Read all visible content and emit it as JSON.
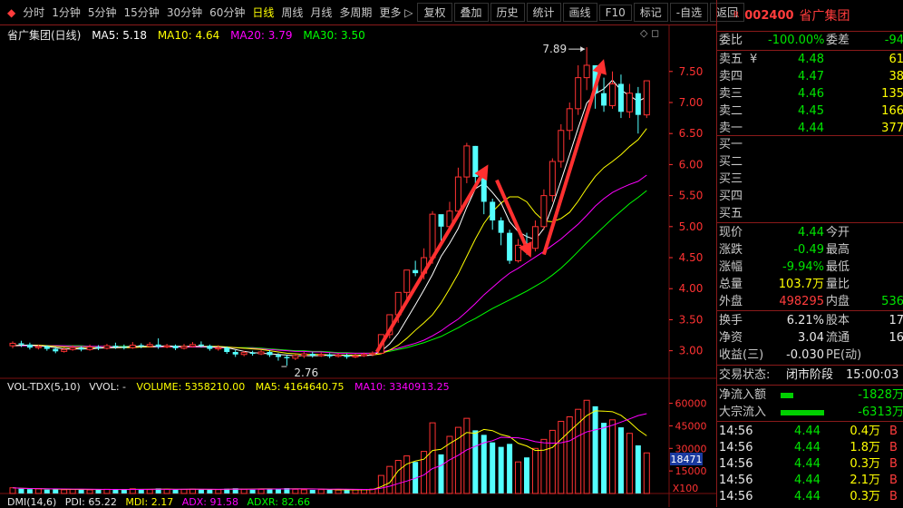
{
  "toolbar": [
    {
      "label": "分时"
    },
    {
      "label": "1分钟"
    },
    {
      "label": "5分钟"
    },
    {
      "label": "15分钟"
    },
    {
      "label": "30分钟"
    },
    {
      "label": "60分钟"
    },
    {
      "label": "日线",
      "active": true
    },
    {
      "label": "周线"
    },
    {
      "label": "月线"
    },
    {
      "label": "多周期"
    },
    {
      "label": "更多 ▷"
    },
    {
      "label": "复权",
      "box": true
    },
    {
      "label": "叠加",
      "box": true
    },
    {
      "label": "历史",
      "box": true
    },
    {
      "label": "统计",
      "box": true
    },
    {
      "label": "画线",
      "box": true
    },
    {
      "label": "F10",
      "box": true
    },
    {
      "label": "标记",
      "box": true
    },
    {
      "label": "-自选",
      "box": true
    },
    {
      "label": "返回",
      "box": true
    }
  ],
  "stock": {
    "badge": "R",
    "code": "002400",
    "name": "省广集团"
  },
  "main_info": {
    "title": "省广集团(日线)",
    "ma5": "MA5: 5.18",
    "ma10": "MA10: 4.64",
    "ma20": "MA20: 3.79",
    "ma30": "MA30: 3.50"
  },
  "vol_info": {
    "title": "VOL-TDX(5,10)",
    "vvol": "VVOL: -",
    "volume": "VOLUME: 5358210.00",
    "ma5": "MA5: 4164640.75",
    "ma10": "MA10: 3340913.25"
  },
  "dmi_info": {
    "title": "DMI(14,6)",
    "pdi": "PDI: 65.22",
    "mdi": "MDI: 2.17",
    "adx": "ADX: 91.58",
    "adxr": "ADXR: 82.66"
  },
  "colors": {
    "up": "#ff3232",
    "down": "#54ffff",
    "ma5": "#ffffff",
    "ma10": "#ffff00",
    "ma20": "#ff00ff",
    "ma30": "#00ff00",
    "grid": "#7a1010"
  },
  "chart_data": {
    "type": "candlestick",
    "ylim": [
      2.6,
      7.95
    ],
    "yticks": [
      "7.50",
      "7.00",
      "6.50",
      "6.00",
      "5.50",
      "5.00",
      "4.50",
      "4.00",
      "3.50",
      "3.00"
    ],
    "annotations": {
      "high": "7.89",
      "low": "2.76"
    },
    "candles": [
      [
        3.08,
        3.12,
        3.15,
        3.04
      ],
      [
        3.12,
        3.1,
        3.16,
        3.06
      ],
      [
        3.1,
        3.05,
        3.13,
        3.02
      ],
      [
        3.05,
        3.07,
        3.1,
        3.02
      ],
      [
        3.07,
        3.03,
        3.09,
        3.0
      ],
      [
        3.03,
        2.99,
        3.06,
        2.96
      ],
      [
        2.99,
        3.02,
        3.05,
        2.97
      ],
      [
        3.02,
        3.05,
        3.09,
        3.0
      ],
      [
        3.05,
        3.02,
        3.07,
        2.99
      ],
      [
        3.02,
        3.06,
        3.1,
        3.0
      ],
      [
        3.06,
        3.04,
        3.09,
        3.01
      ],
      [
        3.04,
        3.08,
        3.11,
        3.02
      ],
      [
        3.08,
        3.06,
        3.13,
        3.03
      ],
      [
        3.06,
        3.05,
        3.1,
        3.02
      ],
      [
        3.05,
        3.09,
        3.14,
        3.03
      ],
      [
        3.09,
        3.07,
        3.12,
        3.04
      ],
      [
        3.07,
        3.1,
        3.14,
        3.05
      ],
      [
        3.1,
        3.06,
        3.2,
        3.03
      ],
      [
        3.06,
        3.08,
        3.11,
        3.04
      ],
      [
        3.08,
        3.04,
        3.1,
        3.01
      ],
      [
        3.04,
        3.07,
        3.11,
        3.02
      ],
      [
        3.07,
        3.1,
        3.14,
        3.05
      ],
      [
        3.1,
        3.08,
        3.15,
        3.05
      ],
      [
        3.08,
        3.03,
        3.1,
        3.0
      ],
      [
        3.03,
        3.05,
        3.09,
        3.0
      ],
      [
        3.05,
        2.98,
        3.07,
        2.95
      ],
      [
        2.98,
        2.94,
        3.01,
        2.9
      ],
      [
        2.94,
        2.97,
        3.0,
        2.91
      ],
      [
        2.97,
        2.95,
        3.0,
        2.92
      ],
      [
        2.95,
        2.98,
        3.01,
        2.93
      ],
      [
        2.98,
        2.93,
        3.01,
        2.9
      ],
      [
        2.93,
        2.9,
        2.96,
        2.84
      ],
      [
        2.9,
        2.88,
        2.93,
        2.76
      ],
      [
        2.88,
        2.92,
        2.95,
        2.85
      ],
      [
        2.92,
        2.95,
        2.98,
        2.88
      ],
      [
        2.95,
        2.92,
        2.98,
        2.89
      ],
      [
        2.92,
        2.94,
        2.97,
        2.9
      ],
      [
        2.94,
        2.91,
        2.96,
        2.88
      ],
      [
        2.91,
        2.93,
        2.96,
        2.89
      ],
      [
        2.93,
        2.9,
        2.95,
        2.87
      ],
      [
        2.9,
        2.92,
        2.95,
        2.88
      ],
      [
        2.92,
        2.94,
        2.97,
        2.9
      ],
      [
        2.94,
        2.96,
        2.99,
        2.91
      ],
      [
        2.96,
        3.26,
        3.26,
        2.95
      ],
      [
        3.26,
        3.58,
        3.58,
        3.2
      ],
      [
        3.58,
        3.94,
        3.94,
        3.45
      ],
      [
        3.94,
        4.3,
        4.3,
        3.8
      ],
      [
        4.3,
        4.25,
        4.45,
        4.2
      ],
      [
        4.25,
        4.5,
        4.65,
        4.15
      ],
      [
        4.5,
        5.2,
        5.25,
        4.4
      ],
      [
        5.2,
        5.0,
        5.15,
        4.7
      ],
      [
        5.0,
        5.25,
        5.4,
        4.95
      ],
      [
        5.25,
        5.8,
        5.95,
        5.15
      ],
      [
        5.8,
        6.3,
        6.35,
        5.7
      ],
      [
        6.3,
        5.8,
        6.3,
        5.6
      ],
      [
        5.8,
        5.4,
        5.9,
        5.2
      ],
      [
        5.4,
        5.1,
        5.45,
        4.95
      ],
      [
        5.1,
        4.9,
        5.15,
        4.7
      ],
      [
        4.9,
        4.45,
        4.95,
        4.4
      ],
      [
        4.45,
        4.7,
        4.8,
        4.42
      ],
      [
        4.7,
        4.65,
        4.9,
        4.55
      ],
      [
        4.65,
        5.0,
        5.1,
        4.6
      ],
      [
        5.0,
        5.5,
        5.6,
        4.95
      ],
      [
        5.5,
        6.05,
        6.1,
        5.4
      ],
      [
        6.05,
        6.55,
        6.65,
        5.95
      ],
      [
        6.55,
        6.9,
        7.0,
        6.4
      ],
      [
        6.9,
        7.4,
        7.6,
        6.8
      ],
      [
        7.4,
        7.6,
        7.89,
        7.2
      ],
      [
        7.6,
        7.15,
        7.6,
        6.9
      ],
      [
        7.15,
        6.95,
        7.4,
        6.85
      ],
      [
        6.95,
        7.3,
        7.5,
        6.9
      ],
      [
        7.3,
        6.85,
        7.45,
        6.75
      ],
      [
        6.85,
        7.15,
        7.3,
        6.75
      ],
      [
        7.15,
        6.8,
        7.25,
        6.5
      ],
      [
        6.8,
        7.35,
        7.35,
        6.75
      ]
    ],
    "ma5": [
      3.08,
      3.09,
      3.09,
      3.08,
      3.07,
      3.05,
      3.03,
      3.03,
      3.03,
      3.03,
      3.04,
      3.05,
      3.05,
      3.06,
      3.07,
      3.07,
      3.07,
      3.07,
      3.08,
      3.07,
      3.07,
      3.07,
      3.07,
      3.06,
      3.06,
      3.05,
      3.02,
      2.99,
      2.97,
      2.96,
      2.95,
      2.94,
      2.93,
      2.92,
      2.92,
      2.92,
      2.92,
      2.93,
      2.93,
      2.92,
      2.92,
      2.92,
      2.93,
      2.99,
      3.11,
      3.28,
      3.51,
      3.74,
      3.98,
      4.23,
      4.52,
      4.73,
      4.97,
      5.31,
      5.61,
      5.7,
      5.55,
      5.38,
      5.08,
      4.92,
      4.84,
      4.79,
      4.97,
      5.33,
      5.74,
      6.16,
      6.59,
      6.99,
      7.14,
      7.22,
      7.36,
      7.2,
      7.11,
      7.02,
      7.09
    ],
    "ma10": [
      3.08,
      3.09,
      3.09,
      3.09,
      3.08,
      3.07,
      3.06,
      3.05,
      3.05,
      3.05,
      3.05,
      3.05,
      3.05,
      3.05,
      3.05,
      3.06,
      3.06,
      3.07,
      3.07,
      3.07,
      3.07,
      3.07,
      3.07,
      3.07,
      3.07,
      3.06,
      3.05,
      3.04,
      3.03,
      3.02,
      3.0,
      2.98,
      2.96,
      2.95,
      2.94,
      2.94,
      2.94,
      2.93,
      2.93,
      2.93,
      2.93,
      2.93,
      2.93,
      2.95,
      3.01,
      3.09,
      3.2,
      3.33,
      3.45,
      3.58,
      3.77,
      4.0,
      4.24,
      4.52,
      4.8,
      5.05,
      5.24,
      5.38,
      5.48,
      5.48,
      5.4,
      5.22,
      5.09,
      5.08,
      5.13,
      5.23,
      5.41,
      5.62,
      5.81,
      5.95,
      6.05,
      6.16,
      6.29,
      6.4,
      6.58
    ],
    "ma20": [
      3.08,
      3.08,
      3.08,
      3.08,
      3.08,
      3.08,
      3.08,
      3.07,
      3.07,
      3.07,
      3.07,
      3.07,
      3.06,
      3.06,
      3.06,
      3.06,
      3.06,
      3.06,
      3.06,
      3.06,
      3.06,
      3.06,
      3.06,
      3.06,
      3.05,
      3.05,
      3.05,
      3.04,
      3.04,
      3.03,
      3.02,
      3.01,
      3.0,
      2.99,
      2.99,
      2.98,
      2.98,
      2.97,
      2.96,
      2.96,
      2.96,
      2.96,
      2.96,
      2.98,
      3.01,
      3.04,
      3.08,
      3.12,
      3.17,
      3.24,
      3.32,
      3.42,
      3.51,
      3.63,
      3.76,
      3.9,
      4.02,
      4.14,
      4.25,
      4.33,
      4.42,
      4.51,
      4.6,
      4.7,
      4.8,
      4.92,
      5.04,
      5.18,
      5.33,
      5.45,
      5.55,
      5.62,
      5.68,
      5.73,
      5.83
    ],
    "ma30": [
      3.08,
      3.08,
      3.08,
      3.08,
      3.08,
      3.08,
      3.08,
      3.08,
      3.08,
      3.07,
      3.07,
      3.07,
      3.07,
      3.07,
      3.07,
      3.07,
      3.07,
      3.07,
      3.07,
      3.07,
      3.07,
      3.06,
      3.06,
      3.06,
      3.06,
      3.05,
      3.05,
      3.05,
      3.05,
      3.04,
      3.03,
      3.02,
      3.01,
      3.0,
      3.0,
      2.99,
      2.99,
      2.98,
      2.97,
      2.97,
      2.96,
      2.96,
      2.96,
      2.97,
      2.99,
      3.02,
      3.05,
      3.09,
      3.13,
      3.18,
      3.23,
      3.3,
      3.37,
      3.45,
      3.52,
      3.6,
      3.68,
      3.75,
      3.82,
      3.89,
      3.96,
      4.04,
      4.12,
      4.22,
      4.33,
      4.46,
      4.6,
      4.74,
      4.87,
      5.0,
      5.13,
      5.25,
      5.37,
      5.47,
      5.58
    ],
    "volume": [
      3800,
      3200,
      2900,
      3100,
      2600,
      2800,
      2500,
      2700,
      3000,
      2400,
      2600,
      2800,
      2900,
      2500,
      3100,
      2700,
      2600,
      3400,
      2800,
      2500,
      2700,
      2900,
      3000,
      2400,
      2600,
      3200,
      3500,
      2800,
      2500,
      2700,
      2900,
      3300,
      3600,
      2800,
      2500,
      2400,
      2600,
      2500,
      2300,
      2600,
      2400,
      2700,
      2900,
      12000,
      18000,
      22000,
      25000,
      21000,
      28000,
      47000,
      26000,
      38000,
      44000,
      50000,
      42000,
      39000,
      34000,
      31000,
      33000,
      21000,
      24000,
      30000,
      36000,
      42000,
      48000,
      51000,
      56000,
      62000,
      58000,
      47000,
      49000,
      44000,
      40000,
      32000,
      27000
    ],
    "vol_ma5": [
      3800,
      3500,
      3300,
      3250,
      3120,
      2920,
      2780,
      2740,
      2720,
      2680,
      2640,
      2700,
      2740,
      2640,
      2780,
      2800,
      2760,
      2860,
      2920,
      2800,
      2800,
      2880,
      2780,
      2700,
      2740,
      2760,
      2940,
      2900,
      2920,
      3060,
      3080,
      3040,
      3120,
      3160,
      3120,
      3060,
      2940,
      2680,
      2460,
      2480,
      2480,
      2500,
      2580,
      4500,
      7200,
      15200,
      19600,
      21600,
      22800,
      28600,
      29400,
      33200,
      36600,
      40600,
      40000,
      42600,
      41800,
      39200,
      37800,
      33400,
      31600,
      28600,
      28800,
      30600,
      36000,
      41400,
      46600,
      51800,
      55000,
      54800,
      54400,
      52000,
      47600,
      42400,
      38400
    ],
    "vol_ma10": [
      3800,
      3500,
      3300,
      3250,
      3120,
      3070,
      3010,
      2970,
      2970,
      2900,
      2780,
      2740,
      2730,
      2670,
      2730,
      2720,
      2760,
      2830,
      2810,
      2820,
      2830,
      2850,
      2860,
      2830,
      2780,
      2850,
      2930,
      2880,
      2830,
      2930,
      2950,
      3020,
      3020,
      3050,
      3070,
      3000,
      2910,
      2880,
      2940,
      2900,
      2780,
      2720,
      2630,
      3570,
      4820,
      6600,
      8260,
      10140,
      12320,
      16600,
      18600,
      22400,
      25400,
      29000,
      31400,
      33700,
      35100,
      37400,
      37200,
      37000,
      36000,
      34500,
      33700,
      33500,
      33700,
      35000,
      38200,
      41000,
      42300,
      43700,
      45400,
      47500,
      49600,
      51800,
      53100
    ],
    "vol_yticks": [
      "60000",
      "45000",
      "30000",
      "15000"
    ],
    "vol_current": "18471",
    "vol_unit": "X100"
  },
  "quote": {
    "webi": {
      "l": "委比",
      "v": "-100.00%",
      "l2": "委差",
      "v2": "-94"
    },
    "sells": [
      {
        "l": "卖五",
        "p": "4.48",
        "q": "61"
      },
      {
        "l": "卖四",
        "p": "4.47",
        "q": "38"
      },
      {
        "l": "卖三",
        "p": "4.46",
        "q": "135"
      },
      {
        "l": "卖二",
        "p": "4.45",
        "q": "166"
      },
      {
        "l": "卖一",
        "p": "4.44",
        "q": "377"
      }
    ],
    "sell5_mark": "¥",
    "buys": [
      {
        "l": "买一"
      },
      {
        "l": "买二"
      },
      {
        "l": "买三"
      },
      {
        "l": "买四"
      },
      {
        "l": "买五"
      }
    ],
    "stats": [
      {
        "l": "现价",
        "v": "4.44",
        "vc": "green",
        "l2": "今开",
        "v2": ""
      },
      {
        "l": "涨跌",
        "v": "-0.49",
        "vc": "green",
        "l2": "最高",
        "v2": ""
      },
      {
        "l": "涨幅",
        "v": "-9.94%",
        "vc": "green",
        "l2": "最低",
        "v2": ""
      },
      {
        "l": "总量",
        "v": "103.7万",
        "vc": "yellow",
        "l2": "量比",
        "v2": ""
      },
      {
        "l": "外盘",
        "v": "498295",
        "vc": "red",
        "l2": "内盘",
        "v2": "536"
      }
    ],
    "stats2": [
      {
        "l": "换手",
        "v": "6.21%",
        "l2": "股本",
        "v2": "17"
      },
      {
        "l": "净资",
        "v": "3.04",
        "l2": "流通",
        "v2": "16"
      },
      {
        "l": "收益(三)",
        "v": "-0.030",
        "l2": "PE(动)",
        "v2": ""
      }
    ],
    "trade_state": {
      "l": "交易状态:",
      "v": "闭市阶段",
      "t": "15:00:03"
    },
    "flows": [
      {
        "l": "净流入额",
        "v": "-1828万"
      },
      {
        "l": "大宗流入",
        "v": "-6313万"
      }
    ],
    "ticks": [
      {
        "t": "14:56",
        "p": "4.44",
        "q": "0.4万",
        "s": "B"
      },
      {
        "t": "14:56",
        "p": "4.44",
        "q": "1.8万",
        "s": "B"
      },
      {
        "t": "14:56",
        "p": "4.44",
        "q": "0.3万",
        "s": "B"
      },
      {
        "t": "14:56",
        "p": "4.44",
        "q": "2.1万",
        "s": "B"
      },
      {
        "t": "14:56",
        "p": "4.44",
        "q": "0.3万",
        "s": "B"
      }
    ]
  }
}
